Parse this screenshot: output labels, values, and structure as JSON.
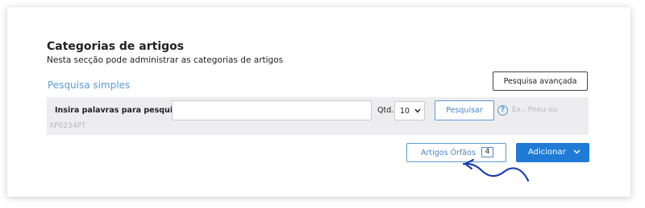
{
  "header": {
    "title": "Categorias de artigos",
    "subtitle": "Nesta secção pode administrar as categorias de artigos"
  },
  "simple_search": {
    "heading": "Pesquisa simples",
    "advanced_label": "Pesquisa avançada",
    "input_label": "Insira palavras para pesquisar",
    "input_value": "",
    "input_placeholder": "",
    "qtd_label": "Qtd.",
    "qtd_value": "10",
    "search_label": "Pesquisar",
    "help_glyph": "?",
    "hint_line1": "Ex.: Pneu ou",
    "hint_line2": "XP0234PT"
  },
  "actions": {
    "orphans_label": "Artigos Órfãos",
    "orphans_count": "4",
    "add_label": "Adicionar"
  },
  "icons": {
    "help": "question-circle-icon",
    "dropdown": "chevron-down-icon",
    "pointer": "curved-arrow-annotation"
  },
  "colors": {
    "accent": "#1f7bd6",
    "link": "#5b9bd5",
    "search_bar_bg": "#ededf0",
    "hint": "#b8b8b8"
  }
}
